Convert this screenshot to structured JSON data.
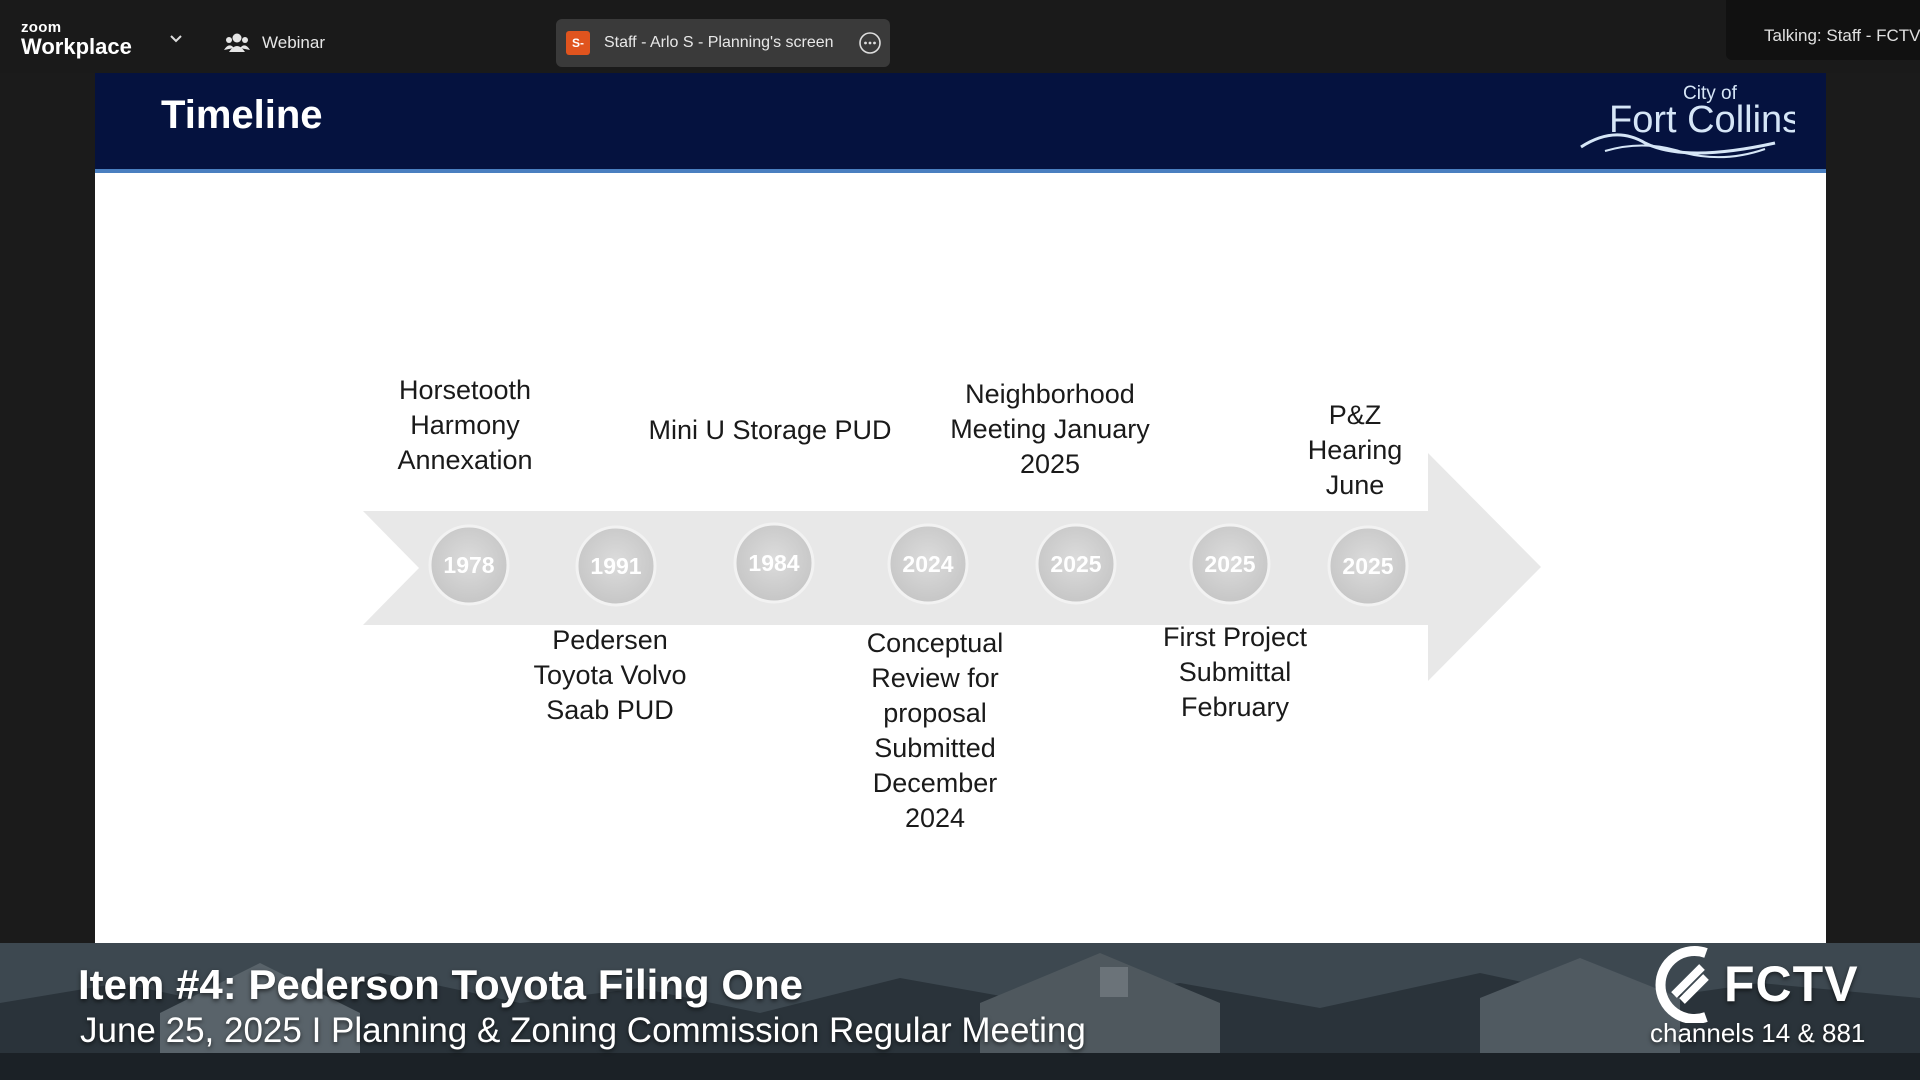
{
  "zoom": {
    "brand_top": "zoom",
    "brand_bottom": "Workplace",
    "webinar_label": "Webinar",
    "share_avatar": "S-",
    "share_label": "Staff - Arlo S - Planning's screen",
    "talking": "Talking: Staff - FCTV"
  },
  "slide": {
    "title": "Timeline",
    "logo_small": "City of",
    "logo_large": "Fort Collins",
    "years": [
      "1978",
      "1991",
      "1984",
      "2024",
      "2025",
      "2025",
      "2025"
    ],
    "labels_top": [
      "Horsetooth\nHarmony\nAnnexation",
      "Mini U Storage PUD",
      "Neighborhood\nMeeting January\n2025",
      "P&Z\nHearing\nJune"
    ],
    "labels_bottom": [
      "Pedersen\nToyota Volvo\nSaab PUD",
      "Conceptual\nReview for\nproposal\nSubmitted\nDecember\n2024",
      "First Project\nSubmittal\nFebruary"
    ]
  },
  "broadcast": {
    "item_title": "Item #4: Pederson Toyota Filing One",
    "item_subtitle": "June 25, 2025  I  Planning & Zoning Commission Regular Meeting",
    "channel_name": "FCTV",
    "channels": "channels 14 & 881"
  },
  "colors": {
    "slide_header": "#05123f",
    "header_rule": "#4a7fc0",
    "arrow": "#e8e8e8",
    "circle": "#d2d2d2",
    "share_avatar": "#e0541e"
  }
}
